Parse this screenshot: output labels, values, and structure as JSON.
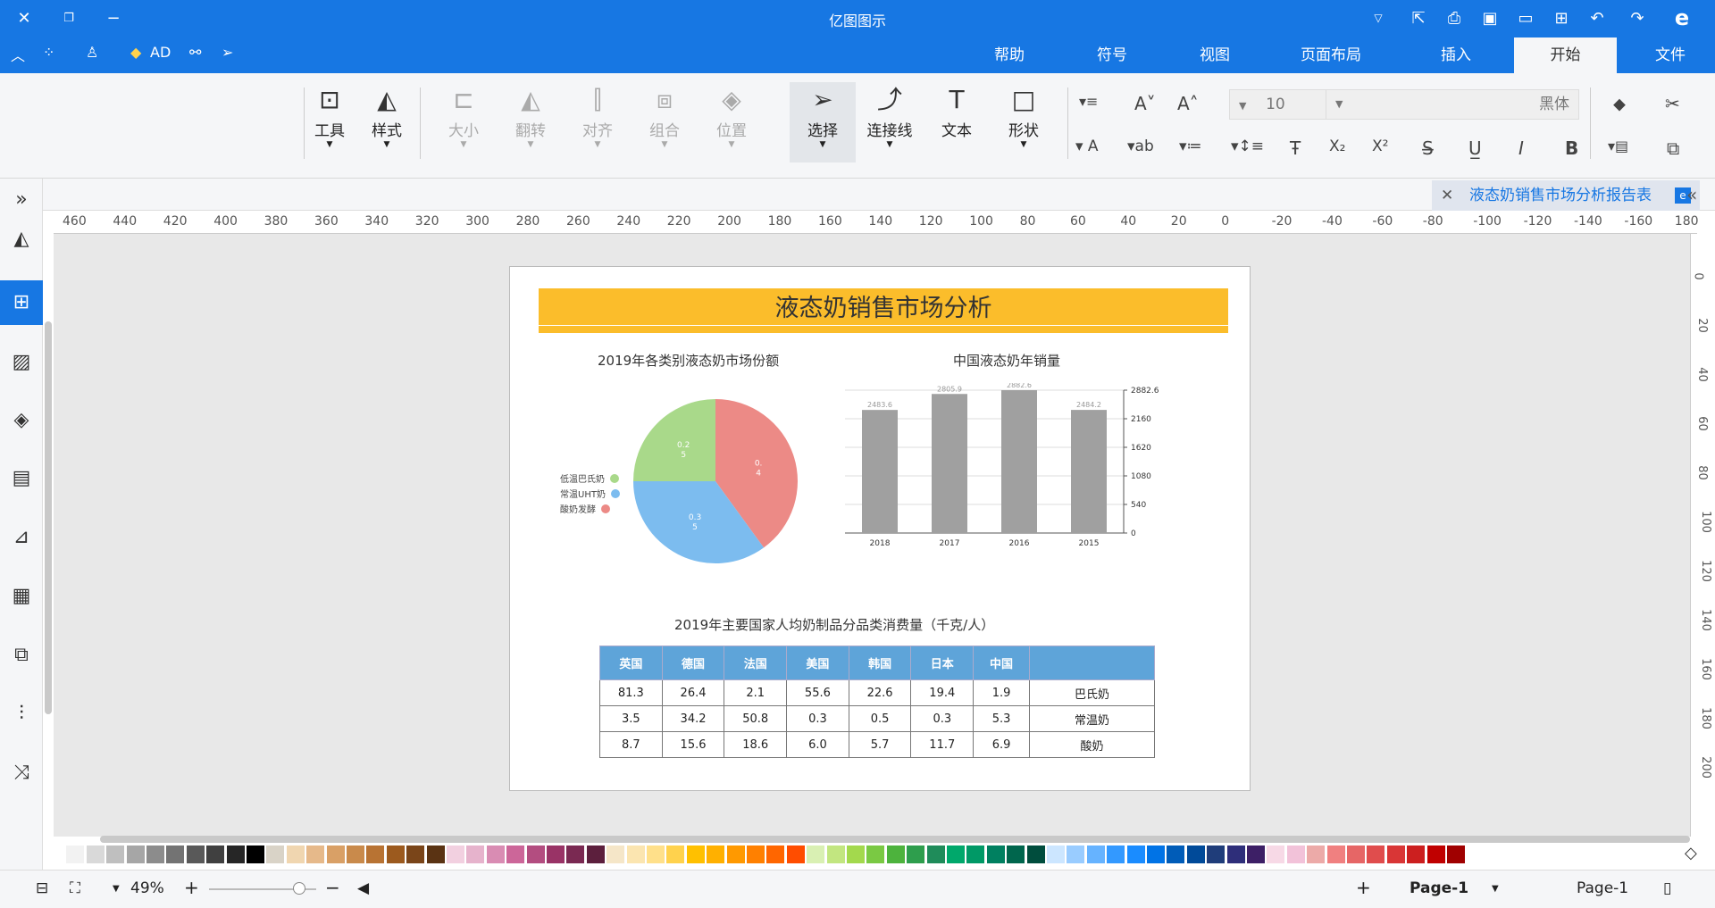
{
  "titlebar": {
    "title": "亿图图示",
    "left_icons": [
      "close-icon",
      "restore-icon",
      "minimize-icon"
    ],
    "right_icons": [
      "more-icon",
      "export-icon",
      "print-icon",
      "save-icon",
      "open-icon",
      "new-icon",
      "undo-icon",
      "redo-icon",
      "app-logo-icon"
    ]
  },
  "menu": {
    "tabs": [
      "帮助",
      "符号",
      "视图",
      "页面布局",
      "插入",
      "开始",
      "文件"
    ],
    "active": "开始",
    "left_label": "AD"
  },
  "ribbon": {
    "tools": [
      {
        "label": "工具",
        "disabled": false
      },
      {
        "label": "样式",
        "disabled": false
      },
      {
        "label": "大小",
        "disabled": true
      },
      {
        "label": "翻转",
        "disabled": true
      },
      {
        "label": "对齐",
        "disabled": true
      },
      {
        "label": "组合",
        "disabled": true
      },
      {
        "label": "位置",
        "disabled": true
      },
      {
        "label": "选择",
        "disabled": false
      },
      {
        "label": "连接线",
        "disabled": false
      },
      {
        "label": "文本",
        "disabled": false
      },
      {
        "label": "形状",
        "disabled": false
      }
    ],
    "font_size": "10",
    "font_name": "黑体"
  },
  "document_tab": {
    "title": "液态奶销售市场分析报告表"
  },
  "hruler": [
    "460",
    "440",
    "420",
    "400",
    "380",
    "360",
    "340",
    "320",
    "300",
    "280",
    "260",
    "240",
    "220",
    "200",
    "180",
    "160",
    "140",
    "120",
    "100",
    "80",
    "60",
    "40",
    "20",
    "0",
    "-20",
    "-40",
    "-60",
    "-80",
    "-100",
    "-120",
    "-140",
    "-160",
    "180"
  ],
  "vruler": [
    "0",
    "20",
    "40",
    "60",
    "80",
    "100",
    "120",
    "140",
    "160",
    "180",
    "200"
  ],
  "page": {
    "banner_title": "液态奶销售市场分析",
    "pie_title": "2019年各类别液态奶市场份额",
    "bar_title": "中国液态奶年销量",
    "table_title": "2019年主要国家人均奶制品分品类消费量（千克/人）",
    "pie_legend": [
      "低温巴氏奶",
      "常温UHT奶",
      "酸奶发酵"
    ],
    "pie_labels": [
      "0.2\n5",
      "0.3\n5",
      "0.\n4"
    ]
  },
  "chart_data": [
    {
      "type": "pie",
      "title": "2019年各类别液态奶市场份额",
      "categories": [
        "低温巴氏奶",
        "常温UHT奶",
        "酸奶发酵"
      ],
      "values": [
        0.25,
        0.35,
        0.4
      ],
      "colors": [
        "#a9d98a",
        "#7cbcef",
        "#ec8a86"
      ]
    },
    {
      "type": "bar",
      "title": "中国液态奶年销量",
      "categories": [
        "2015",
        "2016",
        "2017",
        "2018"
      ],
      "values": [
        2484.2,
        2882.6,
        2805.9,
        2483.6
      ],
      "ylim": [
        0,
        2882.6
      ],
      "yticks": [
        "0",
        "540",
        "1080",
        "1620",
        "2160",
        "2882.6"
      ],
      "color": "#a0a0a0"
    }
  ],
  "table": {
    "headers": [
      "中国",
      "日本",
      "韩国",
      "美国",
      "法国",
      "德国",
      "英国"
    ],
    "rows": [
      {
        "label": "巴氏奶",
        "values": [
          "1.9",
          "19.4",
          "22.6",
          "55.6",
          "2.1",
          "26.4",
          "81.3"
        ]
      },
      {
        "label": "常温奶",
        "values": [
          "5.3",
          "0.3",
          "0.5",
          "0.3",
          "50.8",
          "34.2",
          "3.5"
        ]
      },
      {
        "label": "酸奶",
        "values": [
          "6.9",
          "11.7",
          "5.7",
          "6.0",
          "18.6",
          "15.6",
          "8.7"
        ]
      }
    ]
  },
  "palette": [
    "#ffffff",
    "#f2f2f2",
    "#d9d9d9",
    "#bfbfbf",
    "#a6a6a6",
    "#8c8c8c",
    "#737373",
    "#595959",
    "#404040",
    "#262626",
    "#000000",
    "#d9d3c7",
    "#f0d6b0",
    "#e6b98a",
    "#d9a066",
    "#c98a4b",
    "#b87333",
    "#9c5a1e",
    "#7a4519",
    "#5a3313",
    "#f2d0e0",
    "#e6b3cc",
    "#d98cb3",
    "#cc6699",
    "#b34d80",
    "#993366",
    "#7a2952",
    "#5c1f3d",
    "#f5e6c8",
    "#fbe5b0",
    "#ffe08a",
    "#ffd24d",
    "#ffc000",
    "#ffb000",
    "#ff9900",
    "#ff8000",
    "#ff6600",
    "#ff4d00",
    "#d9f0b3",
    "#c2e680",
    "#a3d94d",
    "#7ac943",
    "#4db33d",
    "#2e9e4d",
    "#1f8c5a",
    "#00a86b",
    "#009966",
    "#008060",
    "#00664d",
    "#004d3d",
    "#cce6ff",
    "#99ccff",
    "#66b3ff",
    "#3399ff",
    "#1a8cff",
    "#0073e6",
    "#005cb8",
    "#004a99",
    "#1f3d7a",
    "#2e2e7a",
    "#3d1f66",
    "#f7d9e6",
    "#f2c2d9",
    "#ecaaa8",
    "#f08080",
    "#e66666",
    "#e04d4d",
    "#d93636",
    "#cc1f1f",
    "#c00000",
    "#a00000"
  ],
  "status": {
    "page_selector": "Page-1",
    "current_page": "Page-1",
    "zoom": "49%"
  }
}
